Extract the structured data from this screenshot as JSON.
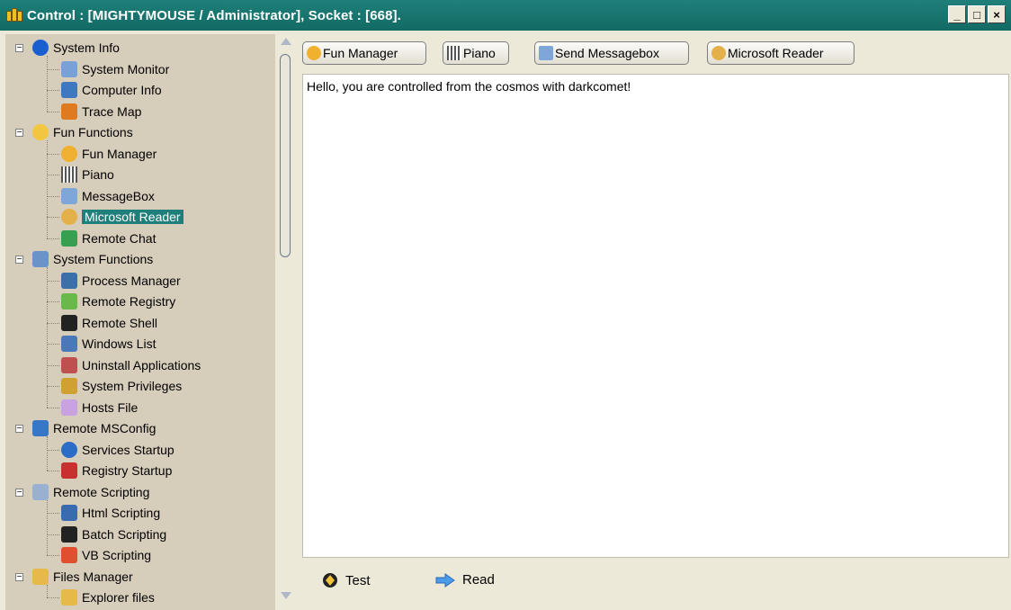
{
  "window": {
    "title": "Control : [MIGHTYMOUSE / Administrator], Socket : [668].",
    "buttons": [
      "_",
      "□",
      "×"
    ]
  },
  "tree": [
    {
      "label": "System Info",
      "icon": "info-icon",
      "color": "#1a5fd0",
      "expander": "−"
    },
    {
      "label": "System Monitor",
      "icon": "chart-icon",
      "color": "#7aa0d8"
    },
    {
      "label": "Computer Info",
      "icon": "computer-icon",
      "color": "#3f78c0"
    },
    {
      "label": "Trace Map",
      "icon": "map-icon",
      "color": "#e07a20"
    },
    {
      "label": "Fun Functions",
      "icon": "smiley-icon",
      "color": "#f3c640",
      "expander": "−"
    },
    {
      "label": "Fun Manager",
      "icon": "smiley-icon",
      "color": "#f0b030"
    },
    {
      "label": "Piano",
      "icon": "piano-icon",
      "color": "#555555"
    },
    {
      "label": "MessageBox",
      "icon": "messagebox-icon",
      "color": "#7ea6d6"
    },
    {
      "label": "Microsoft Reader",
      "icon": "reader-icon",
      "color": "#e3b04a",
      "selected": true
    },
    {
      "label": "Remote Chat",
      "icon": "chat-icon",
      "color": "#36a050"
    },
    {
      "label": "System Functions",
      "icon": "gear-icon",
      "color": "#6a94c8",
      "expander": "−"
    },
    {
      "label": "Process Manager",
      "icon": "process-icon",
      "color": "#3b6fa8"
    },
    {
      "label": "Remote Registry",
      "icon": "cube-icon",
      "color": "#6bb84a"
    },
    {
      "label": "Remote Shell",
      "icon": "terminal-icon",
      "color": "#222222"
    },
    {
      "label": "Windows List",
      "icon": "window-icon",
      "color": "#4b78b8"
    },
    {
      "label": "Uninstall Applications",
      "icon": "uninstall-icon",
      "color": "#c05050"
    },
    {
      "label": "System Privileges",
      "icon": "shield-icon",
      "color": "#d0a030"
    },
    {
      "label": "Hosts File",
      "icon": "file-icon",
      "color": "#c9a2e0"
    },
    {
      "label": "Remote MSConfig",
      "icon": "monitor-icon",
      "color": "#3876c8",
      "expander": "−"
    },
    {
      "label": "Services Startup",
      "icon": "services-icon",
      "color": "#2a6cc8"
    },
    {
      "label": "Registry Startup",
      "icon": "toolbox-icon",
      "color": "#c83030"
    },
    {
      "label": "Remote Scripting",
      "icon": "script-icon",
      "color": "#9ab0d0",
      "expander": "−"
    },
    {
      "label": "Html Scripting",
      "icon": "html-icon",
      "color": "#3a6ab0"
    },
    {
      "label": "Batch Scripting",
      "icon": "batch-icon",
      "color": "#222222"
    },
    {
      "label": "VB Scripting",
      "icon": "vb-icon",
      "color": "#e05030"
    },
    {
      "label": "Files Manager",
      "icon": "folder-icon",
      "color": "#e5b94a",
      "expander": "−"
    },
    {
      "label": "Explorer files",
      "icon": "folder-icon",
      "color": "#e5b94a"
    }
  ],
  "toolbar": [
    {
      "label": "Fun Manager",
      "icon": "smiley-icon",
      "color": "#f0b030"
    },
    {
      "label": "Piano",
      "icon": "piano-icon",
      "color": "#555555"
    },
    {
      "label": "Send Messagebox",
      "icon": "messagebox-icon",
      "color": "#7ea6d6"
    },
    {
      "label": "Microsoft Reader",
      "icon": "reader-icon",
      "color": "#e3b04a"
    }
  ],
  "content": {
    "text": "Hello, you are controlled from the cosmos with darkcomet!"
  },
  "actions": [
    {
      "label": "Test",
      "icon": "test-icon"
    },
    {
      "label": "Read",
      "icon": "arrow-right-icon"
    }
  ]
}
